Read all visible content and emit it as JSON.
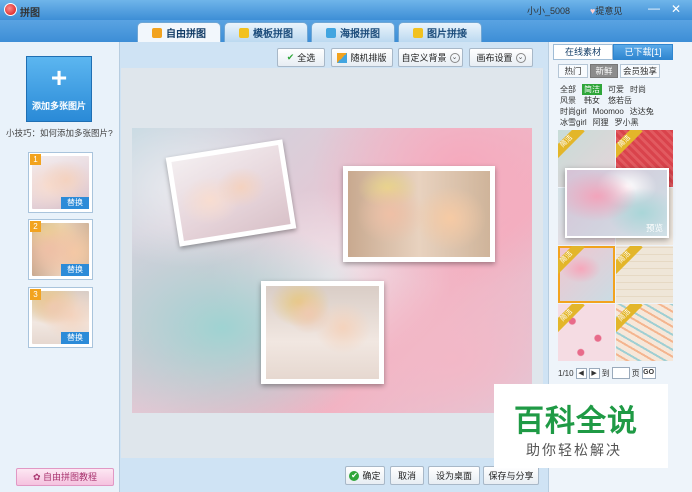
{
  "window": {
    "title": "拼图",
    "user": "小小_5008",
    "feedback": "提意见",
    "minimize": "—",
    "close": "✕"
  },
  "tabs": [
    {
      "label": "自由拼图",
      "active": true,
      "icon_color": "#f2a31f"
    },
    {
      "label": "模板拼图",
      "active": false,
      "icon_color": "#f2c11f"
    },
    {
      "label": "海报拼图",
      "active": false,
      "icon_color": "#42a5e0"
    },
    {
      "label": "图片拼接",
      "active": false,
      "icon_color": "#f2c11f"
    }
  ],
  "left": {
    "add_plus": "+",
    "add_label": "添加多张图片",
    "tip": "小技巧：如何添加多张图片?",
    "thumbnails": [
      {
        "num": "1",
        "replace": "替换"
      },
      {
        "num": "2",
        "replace": "替换"
      },
      {
        "num": "3",
        "replace": "替换"
      }
    ],
    "tutorial": "自由拼图教程"
  },
  "toolbar": {
    "select_all": "全选",
    "random_layout": "随机排版",
    "custom_bg": "自定义背景",
    "canvas_settings": "画布设置"
  },
  "bottom": {
    "confirm": "确定",
    "cancel": "取消",
    "set_desktop": "设为桌面",
    "save_share": "保存与分享"
  },
  "right": {
    "tab_online": "在线素材",
    "tab_downloaded": "已下载[1]",
    "subtabs": [
      {
        "label": "热门",
        "active": false
      },
      {
        "label": "新鲜",
        "active": true
      },
      {
        "label": "会员独享",
        "active": false
      }
    ],
    "keywords": [
      [
        "全部",
        "简洁",
        "可爱",
        "时尚"
      ],
      [
        "风景",
        "韩女",
        "悠若岳"
      ],
      [
        "时尚girl",
        "Moomoo",
        "达达兔"
      ],
      [
        "冰雪girl",
        "阿狸",
        "罗小黑"
      ]
    ],
    "active_keyword": "简洁",
    "ribbon": "简洁",
    "preview": "预览",
    "pager": {
      "page": "1/10",
      "prev": "◀",
      "next": "▶",
      "to": "到",
      "page_unit": "页",
      "go": "GO"
    }
  },
  "watermark": {
    "title": "百科全说",
    "subtitle": "助你轻松解决"
  }
}
